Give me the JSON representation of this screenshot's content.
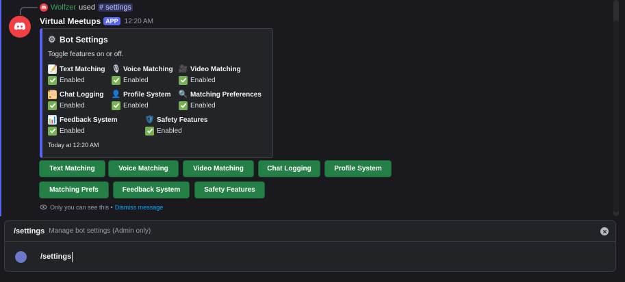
{
  "reply": {
    "username": "Wolfzer",
    "used_text": "used",
    "command": "settings",
    "username_color": "#3ba55c"
  },
  "message": {
    "bot_name": "Virtual Meetups",
    "app_tag": "APP",
    "time": "12:20 AM",
    "avatar_icon": "discord-logo-icon",
    "avatar_color": "#f23f43"
  },
  "embed": {
    "accent_color": "#5865f2",
    "title_icon": "gear-icon",
    "title": "Bot Settings",
    "description": "Toggle features on or off.",
    "fields": [
      {
        "name": "Text Matching",
        "icon": "memo-icon",
        "value": "Enabled"
      },
      {
        "name": "Voice Matching",
        "icon": "microphone-icon",
        "value": "Enabled"
      },
      {
        "name": "Video Matching",
        "icon": "video-camera-icon",
        "value": "Enabled"
      },
      {
        "name": "Chat Logging",
        "icon": "scroll-icon",
        "value": "Enabled"
      },
      {
        "name": "Profile System",
        "icon": "person-icon",
        "value": "Enabled"
      },
      {
        "name": "Matching Preferences",
        "icon": "magnifier-icon",
        "value": "Enabled"
      },
      {
        "name": "Feedback System",
        "icon": "bar-chart-icon",
        "value": "Enabled"
      },
      {
        "name": "Safety Features",
        "icon": "shield-icon",
        "value": "Enabled"
      }
    ],
    "footer": "Today at 12:20 AM"
  },
  "buttons": [
    {
      "label": "Text Matching"
    },
    {
      "label": "Voice Matching"
    },
    {
      "label": "Video Matching"
    },
    {
      "label": "Chat Logging"
    },
    {
      "label": "Profile System"
    },
    {
      "label": "Matching Prefs"
    },
    {
      "label": "Feedback System"
    },
    {
      "label": "Safety Features"
    }
  ],
  "button_color": "#248046",
  "ephemeral": {
    "note": "Only you can see this •",
    "link": "Dismiss message"
  },
  "command_bar": {
    "command_name": "/settings",
    "command_desc": "Manage bot settings (Admin only)",
    "input_value": "/settings"
  }
}
